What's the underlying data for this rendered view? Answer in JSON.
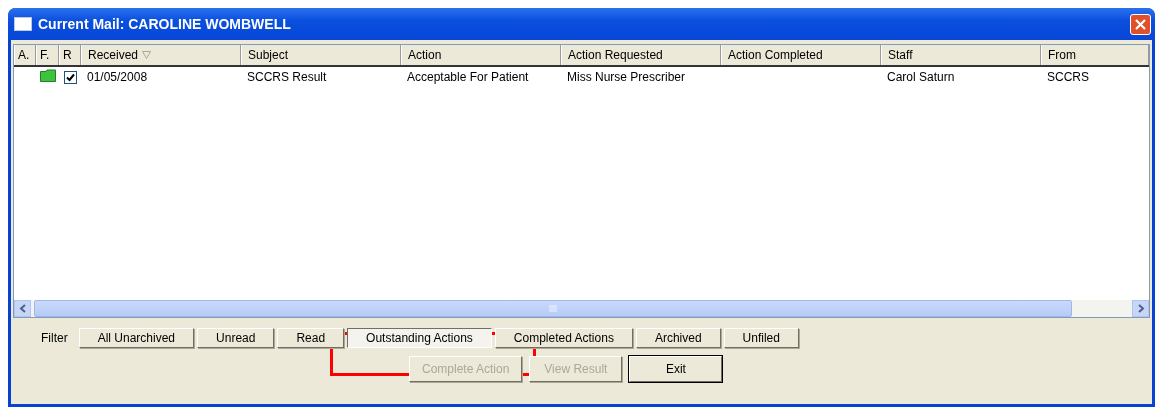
{
  "window": {
    "title": "Current Mail: CAROLINE WOMBWELL"
  },
  "table": {
    "columns": [
      {
        "label": "A."
      },
      {
        "label": "F."
      },
      {
        "label": "R"
      },
      {
        "label": "Received",
        "sorted": true
      },
      {
        "label": "Subject"
      },
      {
        "label": "Action"
      },
      {
        "label": "Action Requested"
      },
      {
        "label": "Action Completed"
      },
      {
        "label": "Staff"
      },
      {
        "label": "From"
      }
    ],
    "rows": [
      {
        "filed": true,
        "read": true,
        "received": "01/05/2008",
        "subject": "SCCRS Result",
        "action": "Acceptable For Patient",
        "action_requested": "Miss Nurse Prescriber",
        "action_completed": "",
        "staff": "Carol Saturn",
        "from": "SCCRS"
      }
    ]
  },
  "filter": {
    "label": "Filter",
    "buttons": [
      {
        "label": "All Unarchived",
        "selected": false
      },
      {
        "label": "Unread",
        "selected": false
      },
      {
        "label": "Read",
        "selected": false
      },
      {
        "label": "Outstanding Actions",
        "selected": true
      },
      {
        "label": "Completed Actions",
        "selected": false
      },
      {
        "label": "Archived",
        "selected": false
      },
      {
        "label": "Unfiled",
        "selected": false
      }
    ]
  },
  "actions": [
    {
      "label": "Complete Action",
      "disabled": true,
      "default": false
    },
    {
      "label": "View Result",
      "disabled": true,
      "default": false
    },
    {
      "label": "Exit",
      "disabled": false,
      "default": true
    }
  ]
}
